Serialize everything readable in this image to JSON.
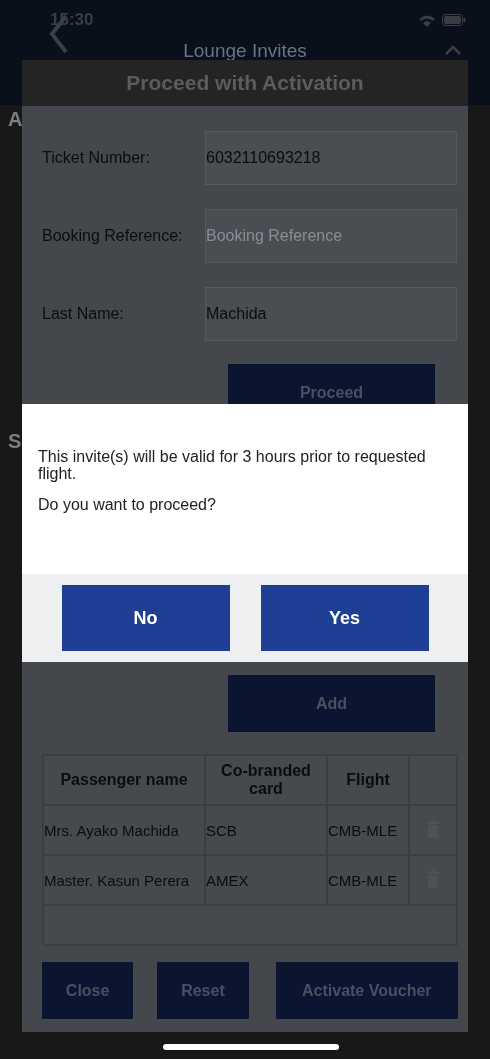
{
  "status_bar": {
    "time": "15:30"
  },
  "header": {
    "title": "Lounge Invites"
  },
  "background_headings": [
    "A",
    "S"
  ],
  "modal": {
    "title": "Proceed with Activation",
    "fields": [
      {
        "label": "Ticket Number:",
        "value": "6032110693218"
      },
      {
        "label": "Booking Reference:",
        "placeholder": "Booking Reference"
      },
      {
        "label": "Last Name:",
        "value": "Machida"
      }
    ],
    "proceed_button": "Proceed",
    "add_button": "Add",
    "table": {
      "columns": [
        "Passenger name",
        "Co-branded card",
        "Flight"
      ],
      "rows": [
        {
          "passenger": "Mrs. Ayako Machida",
          "card": "SCB",
          "flight": "CMB-MLE"
        },
        {
          "passenger": "Master. Kasun Perera",
          "card": "AMEX",
          "flight": "CMB-MLE"
        }
      ]
    },
    "buttons": [
      "Close",
      "Reset",
      "Activate Voucher"
    ]
  },
  "alert": {
    "message": "This invite(s) will be valid for 3 hours prior to requested flight.",
    "question": "Do you want to proceed?",
    "buttons": [
      "No",
      "Yes"
    ]
  }
}
